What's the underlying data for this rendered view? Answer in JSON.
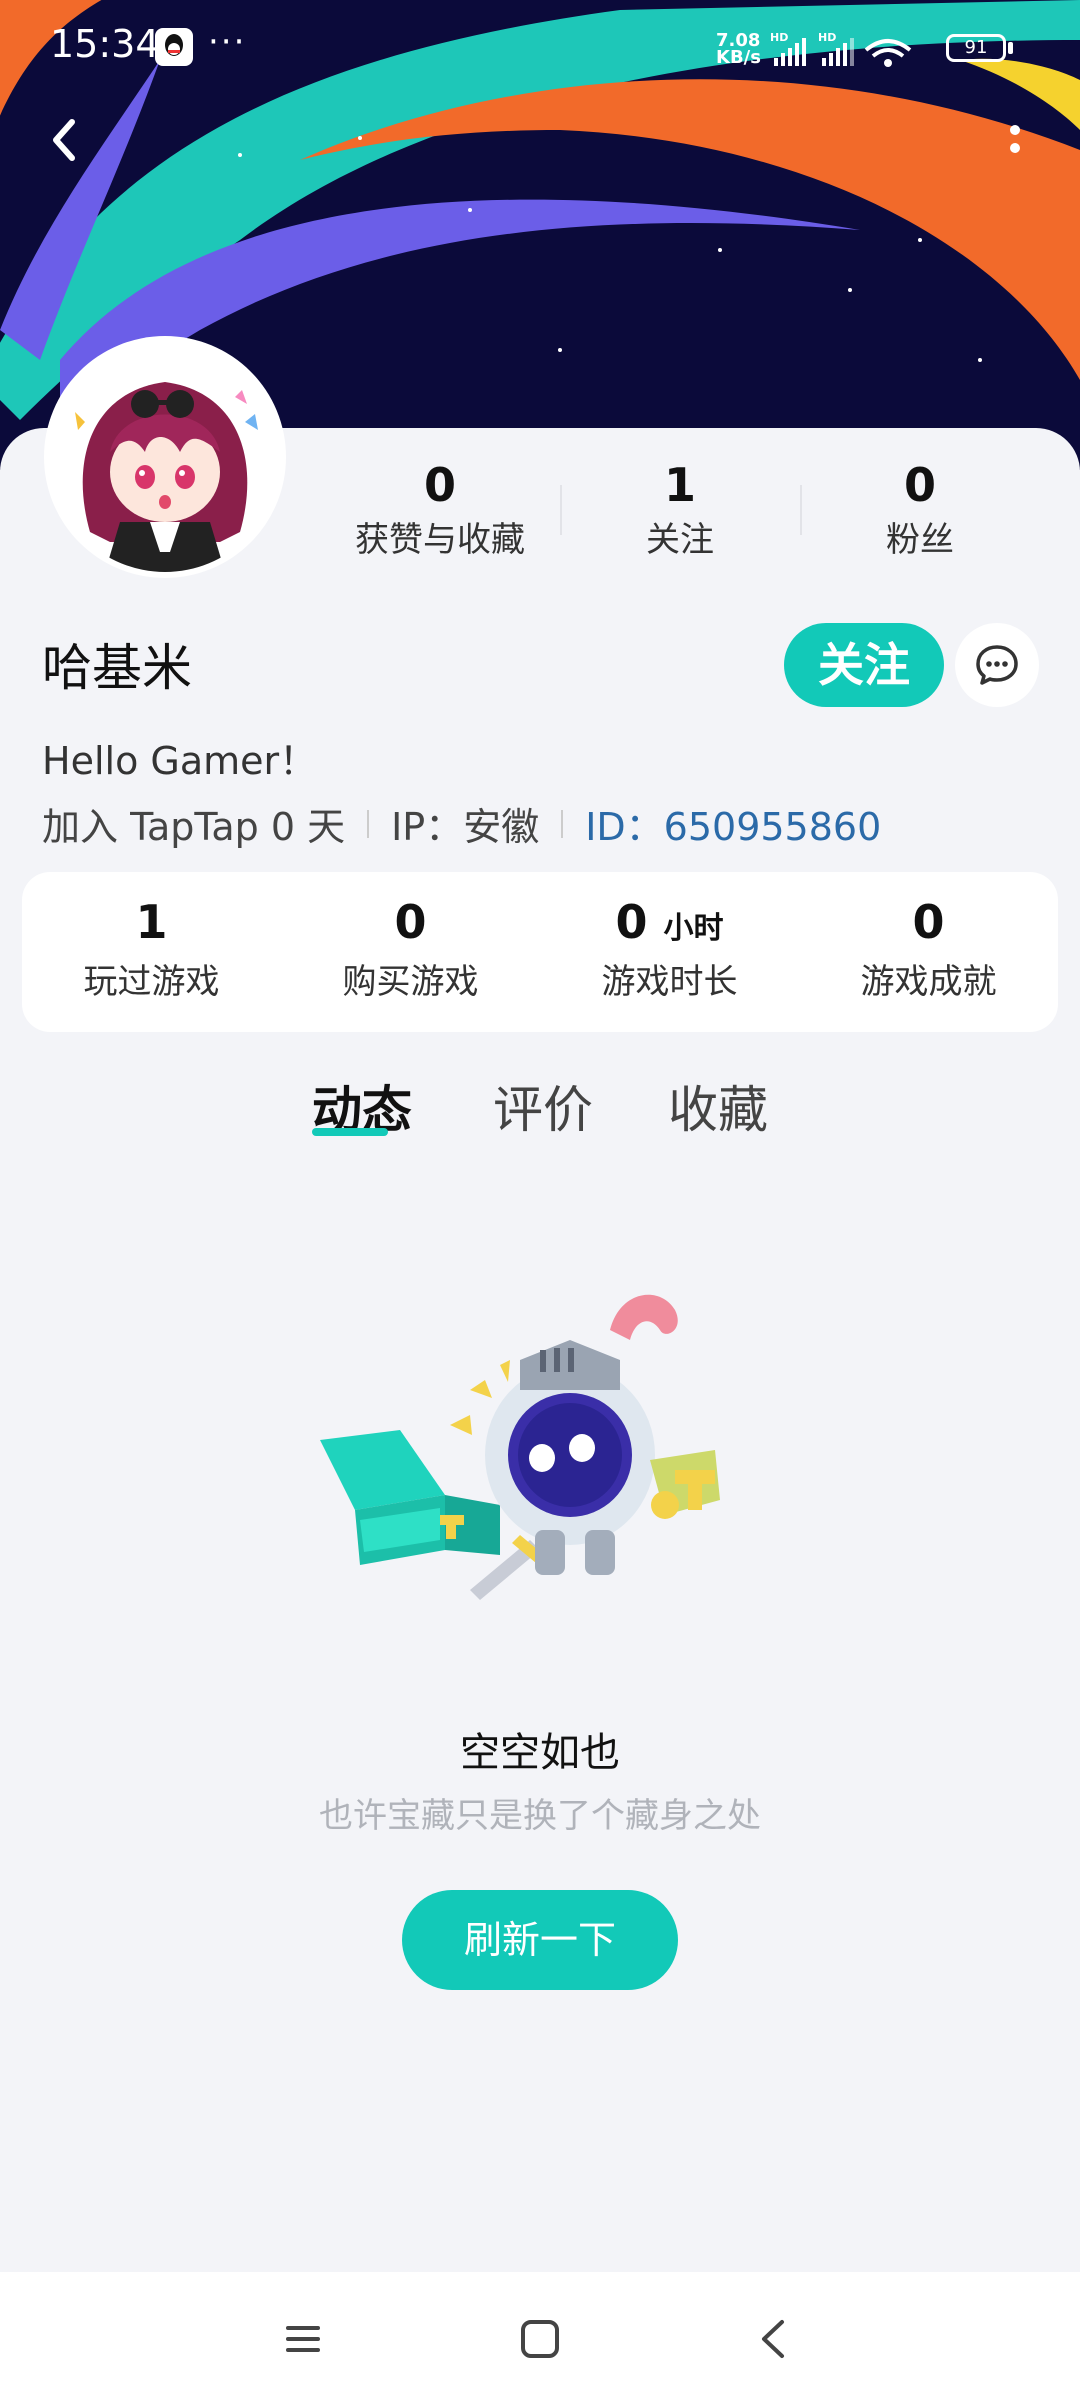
{
  "status_bar": {
    "time": "15:34",
    "extra": "···",
    "net_speed_value": "7.08",
    "net_speed_unit": "KB/s",
    "battery": "91"
  },
  "profile": {
    "username": "哈基米",
    "bio": "Hello Gamer！",
    "joined": "加入 TapTap 0 天",
    "ip": "IP：安徽",
    "id": "ID：650955860"
  },
  "stats": [
    {
      "value": "0",
      "label": "获赞与收藏"
    },
    {
      "value": "1",
      "label": "关注"
    },
    {
      "value": "0",
      "label": "粉丝"
    }
  ],
  "actions": {
    "follow_label": "关注"
  },
  "game_stats": [
    {
      "value": "1",
      "unit": "",
      "label": "玩过游戏"
    },
    {
      "value": "0",
      "unit": "",
      "label": "购买游戏"
    },
    {
      "value": "0",
      "unit": "小时",
      "label": "游戏时长"
    },
    {
      "value": "0",
      "unit": "",
      "label": "游戏成就"
    }
  ],
  "tabs": [
    {
      "label": "动态",
      "active": true
    },
    {
      "label": "评价",
      "active": false
    },
    {
      "label": "收藏",
      "active": false
    }
  ],
  "empty_state": {
    "title": "空空如也",
    "subtitle": "也许宝藏只是换了个藏身之处",
    "button_label": "刷新一下"
  },
  "colors": {
    "accent": "#12c9b8",
    "banner_bg": "#0b0a3a",
    "id_text": "#2b6aa8"
  }
}
